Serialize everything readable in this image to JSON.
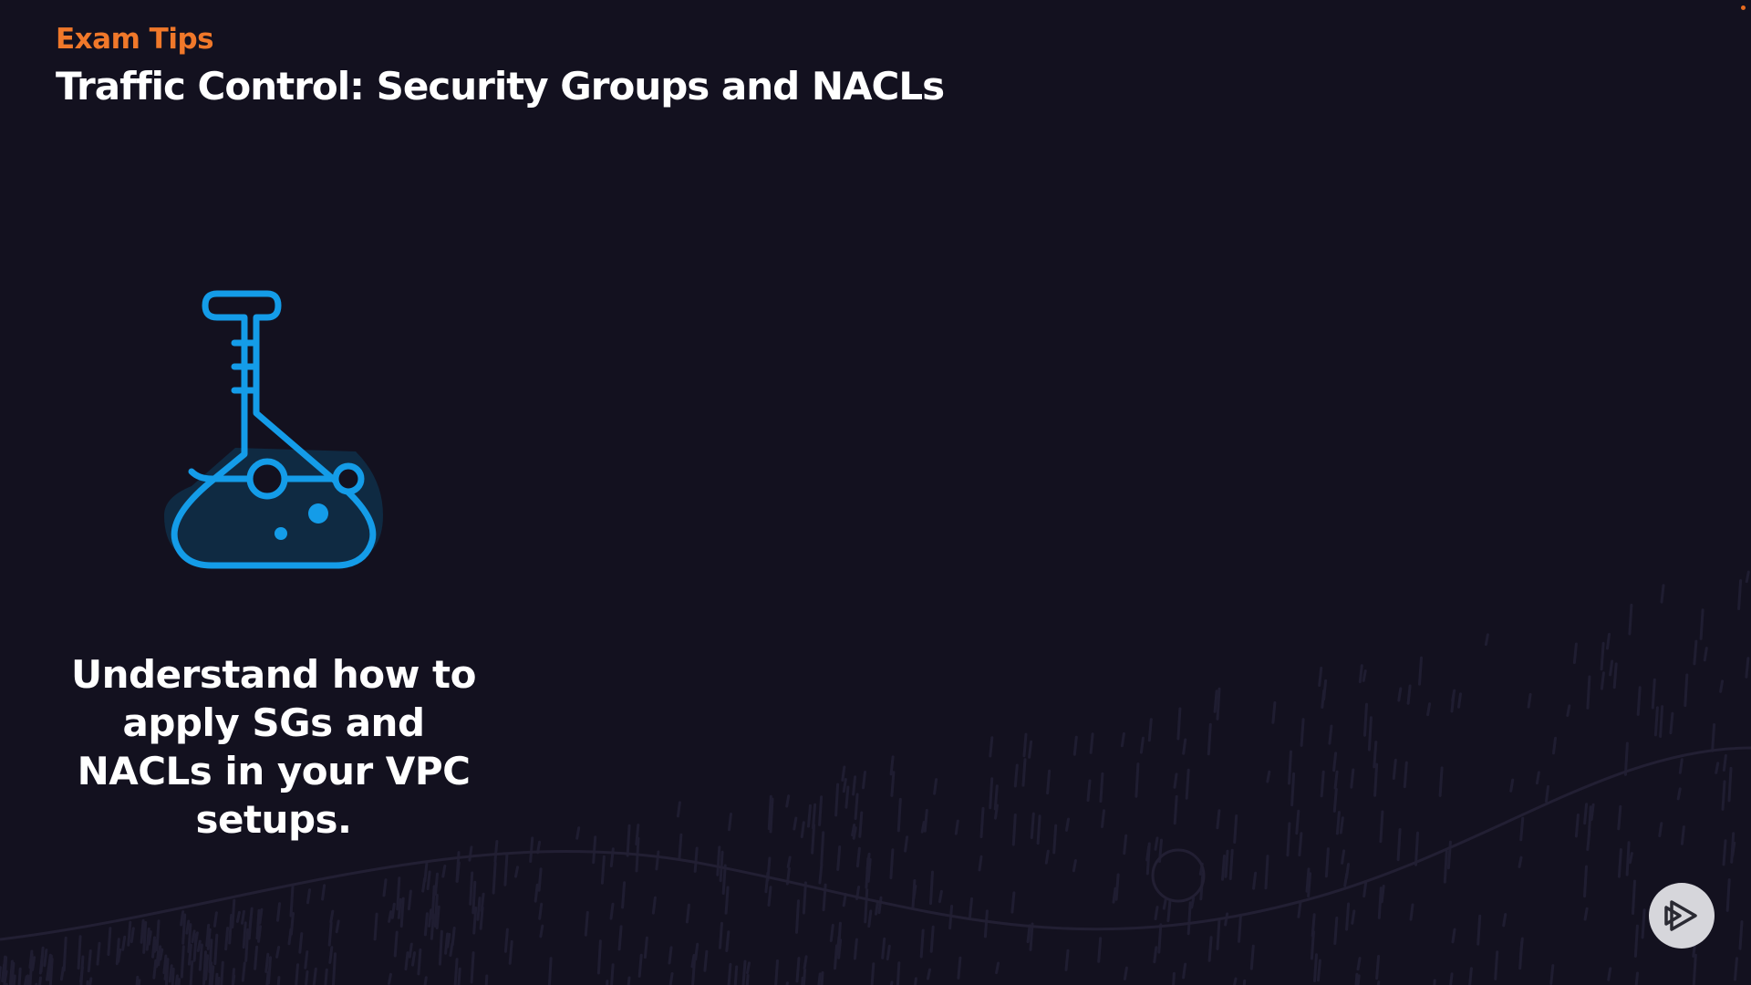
{
  "slide": {
    "eyebrow": "Exam Tips",
    "title": "Traffic Control: Security Groups and NACLs",
    "tip": "Understand how to apply SGs and NACLs in your VPC setups."
  },
  "icons": {
    "main": "flask-icon",
    "logo": "pluralsight-play-icon"
  },
  "colors": {
    "background": "#13111f",
    "eyebrow": "#f0782a",
    "text": "#ffffff",
    "icon_stroke": "#149ce8",
    "icon_fill": "#0f2a42",
    "logo_bg": "#d6d6db",
    "logo_fg": "#2a2a33"
  }
}
